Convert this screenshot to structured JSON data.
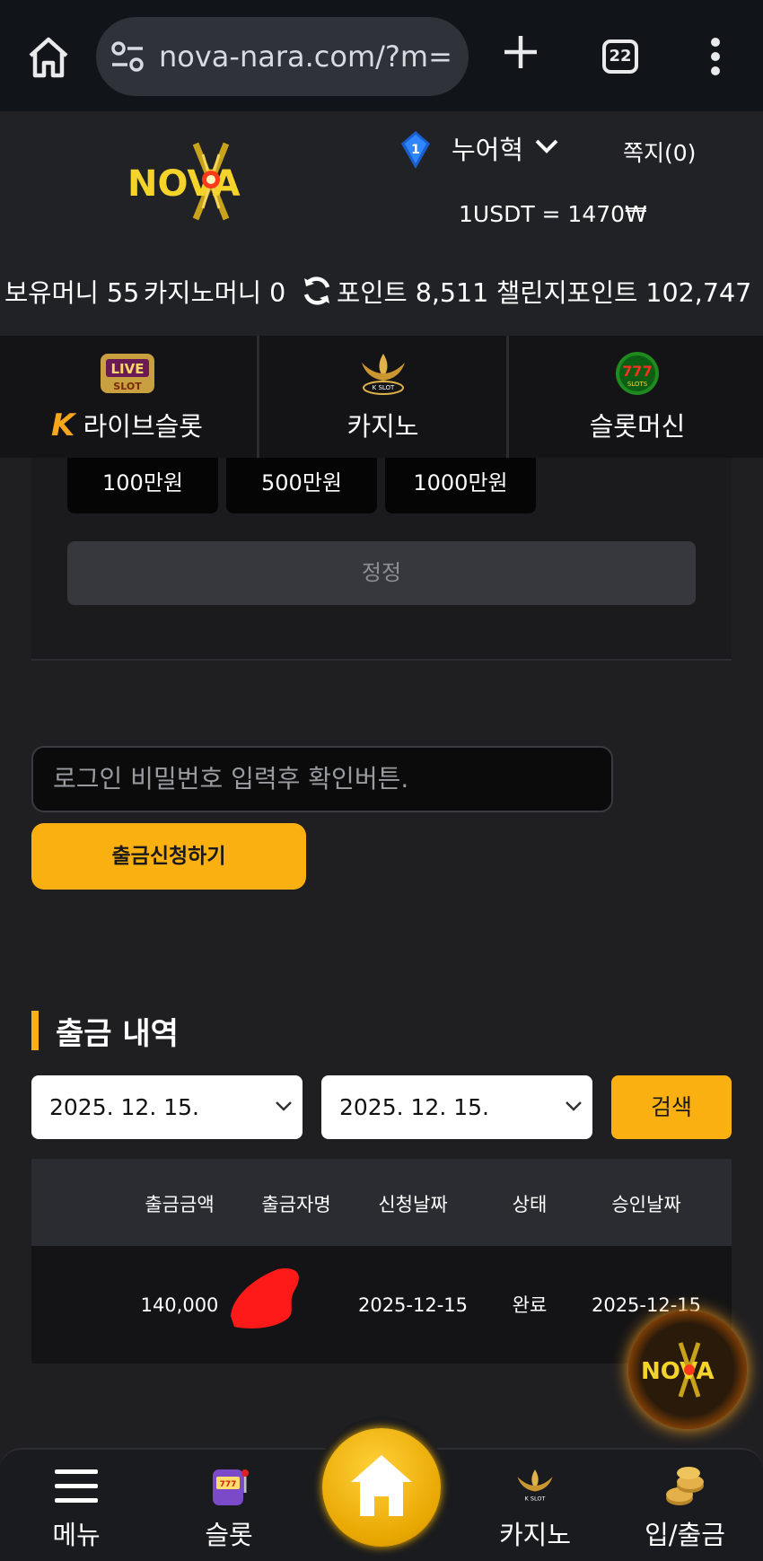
{
  "browser": {
    "url": "nova-nara.com/?m=",
    "tab_count": "22"
  },
  "header": {
    "logo_text": "NOVA",
    "level": "1",
    "username": "누어혁",
    "memo": "쪽지(0)",
    "rate": "1USDT = 1470₩"
  },
  "balances": {
    "holding": "보유머니 55",
    "casino": "카지노머니 0",
    "points": "포인트 8,511",
    "challenge_points": "챌린지포인트 102,747"
  },
  "categories": [
    {
      "label": "라이브슬롯",
      "icon": "live-slot-icon"
    },
    {
      "label": "카지노",
      "icon": "k-slot-icon"
    },
    {
      "label": "슬롯머신",
      "icon": "777-slots-icon"
    }
  ],
  "amounts": [
    "100만원",
    "500만원",
    "1000만원"
  ],
  "reset_label": "정정",
  "password": {
    "placeholder": "로그인 비밀번호 입력후 확인버튼."
  },
  "withdraw_button": "출금신청하기",
  "history": {
    "title": "출금 내역",
    "start_date": "2025. 12. 15.",
    "end_date": "2025. 12. 15.",
    "search_label": "검색",
    "columns": [
      "출금금액",
      "출금자명",
      "신청날짜",
      "상태",
      "승인날짜"
    ],
    "rows": [
      {
        "amount": "140,000",
        "name": "",
        "requested": "2025-12-15",
        "status": "완료",
        "approved": "2025-12-15"
      }
    ]
  },
  "bottom_nav": [
    {
      "label": "메뉴",
      "icon": "hamburger-menu-icon"
    },
    {
      "label": "슬롯",
      "icon": "slot-machine-icon"
    },
    {
      "label": "",
      "icon": "home-icon"
    },
    {
      "label": "카지노",
      "icon": "k-slot-icon"
    },
    {
      "label": "입/출금",
      "icon": "coins-icon"
    }
  ],
  "colors": {
    "accent": "#fbb012",
    "background": "#1f1f22",
    "browser_bar": "#111418"
  }
}
